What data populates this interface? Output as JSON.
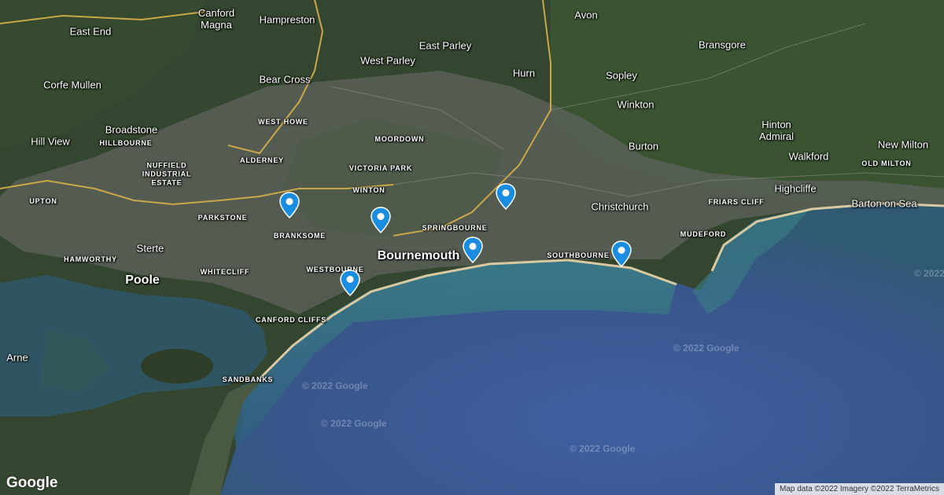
{
  "map": {
    "labels": {
      "east_end": "East End",
      "canford_magna": "Canford\nMagna",
      "hampreston": "Hampreston",
      "avon": "Avon",
      "east_parley": "East Parley",
      "west_parley": "West Parley",
      "bransgore": "Bransgore",
      "corfe_mullen": "Corfe Mullen",
      "bear_cross": "Bear Cross",
      "hurn": "Hurn",
      "sopley": "Sopley",
      "winkton": "Winkton",
      "broadstone": "Broadstone",
      "hillbourne": "HILLBOURNE",
      "west_howe": "WEST HOWE",
      "moordown": "MOORDOWN",
      "hill_view": "Hill View",
      "hinton_admiral": "Hinton\nAdmiral",
      "burton": "Burton",
      "new_milton": "New Milton",
      "nuffield_industrial_estate": "NUFFIELD\nINDUSTRIAL\nESTATE",
      "alderney": "ALDERNEY",
      "victoria_park": "VICTORIA PARK",
      "walkford": "Walkford",
      "old_milton": "OLD MILTON",
      "winton": "WINTON",
      "highcliffe": "Highcliffe",
      "upton": "UPTON",
      "christchurch": "Christchurch",
      "friars_cliff": "FRIARS CLIFF",
      "barton_on_sea": "Barton on Sea",
      "parkstone": "PARKSTONE",
      "springbourne": "SPRINGBOURNE",
      "branksome": "BRANKSOME",
      "mudeford": "MUDEFORD",
      "sterte": "Sterte",
      "bournemouth": "Bournemouth",
      "southbourne": "SOUTHBOURNE",
      "hamworthy": "HAMWORTHY",
      "whitecliff": "WHITECLIFF",
      "westbourne": "WESTBOURNE",
      "poole": "Poole",
      "canford_cliffs": "CANFORD CLIFFS",
      "arne": "Arne",
      "sandbanks": "SANDBANKS"
    },
    "watermark": "© 2022 Google",
    "logo": "Google",
    "attribution": "Map data ©2022 Imagery ©2022 TerraMetrics",
    "pin_color": "#1a8de0",
    "water_color": "#3e5f98"
  }
}
